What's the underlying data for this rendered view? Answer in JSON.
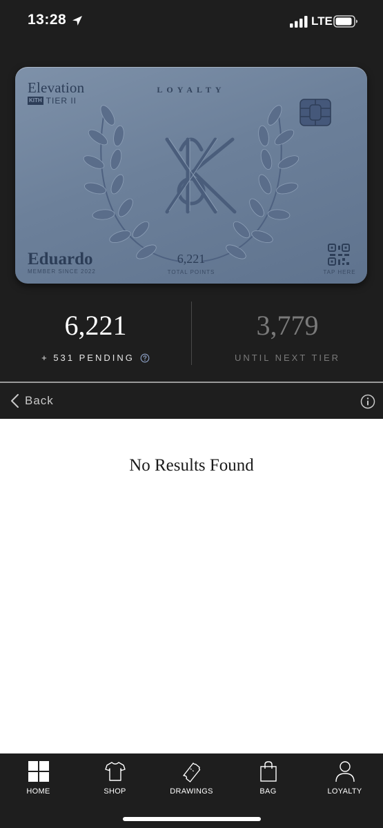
{
  "status_bar": {
    "time": "13:28",
    "network": "LTE",
    "icons": [
      "location-arrow-icon",
      "signal-icon",
      "battery-icon"
    ]
  },
  "card": {
    "program": "Elevation",
    "brand_badge": "KITH",
    "tier": "TIER II",
    "heading": "LOYALTY",
    "member_name": "Eduardo",
    "member_since": "MEMBER SINCE 2022",
    "points": "6,221",
    "points_label": "TOTAL POINTS",
    "tap_label": "TAP HERE",
    "color": "#6c809a"
  },
  "stats": {
    "points": "6,221",
    "pending": "+ 531 PENDING",
    "remaining": "3,779",
    "remaining_label": "UNTIL NEXT TIER"
  },
  "nav": {
    "back_label": "Back"
  },
  "content": {
    "empty_message": "No Results Found"
  },
  "tabs": [
    {
      "label": "HOME",
      "icon": "home-grid-icon"
    },
    {
      "label": "SHOP",
      "icon": "tshirt-icon"
    },
    {
      "label": "DRAWINGS",
      "icon": "ticket-icon"
    },
    {
      "label": "BAG",
      "icon": "shopping-bag-icon"
    },
    {
      "label": "LOYALTY",
      "icon": "user-icon"
    }
  ]
}
